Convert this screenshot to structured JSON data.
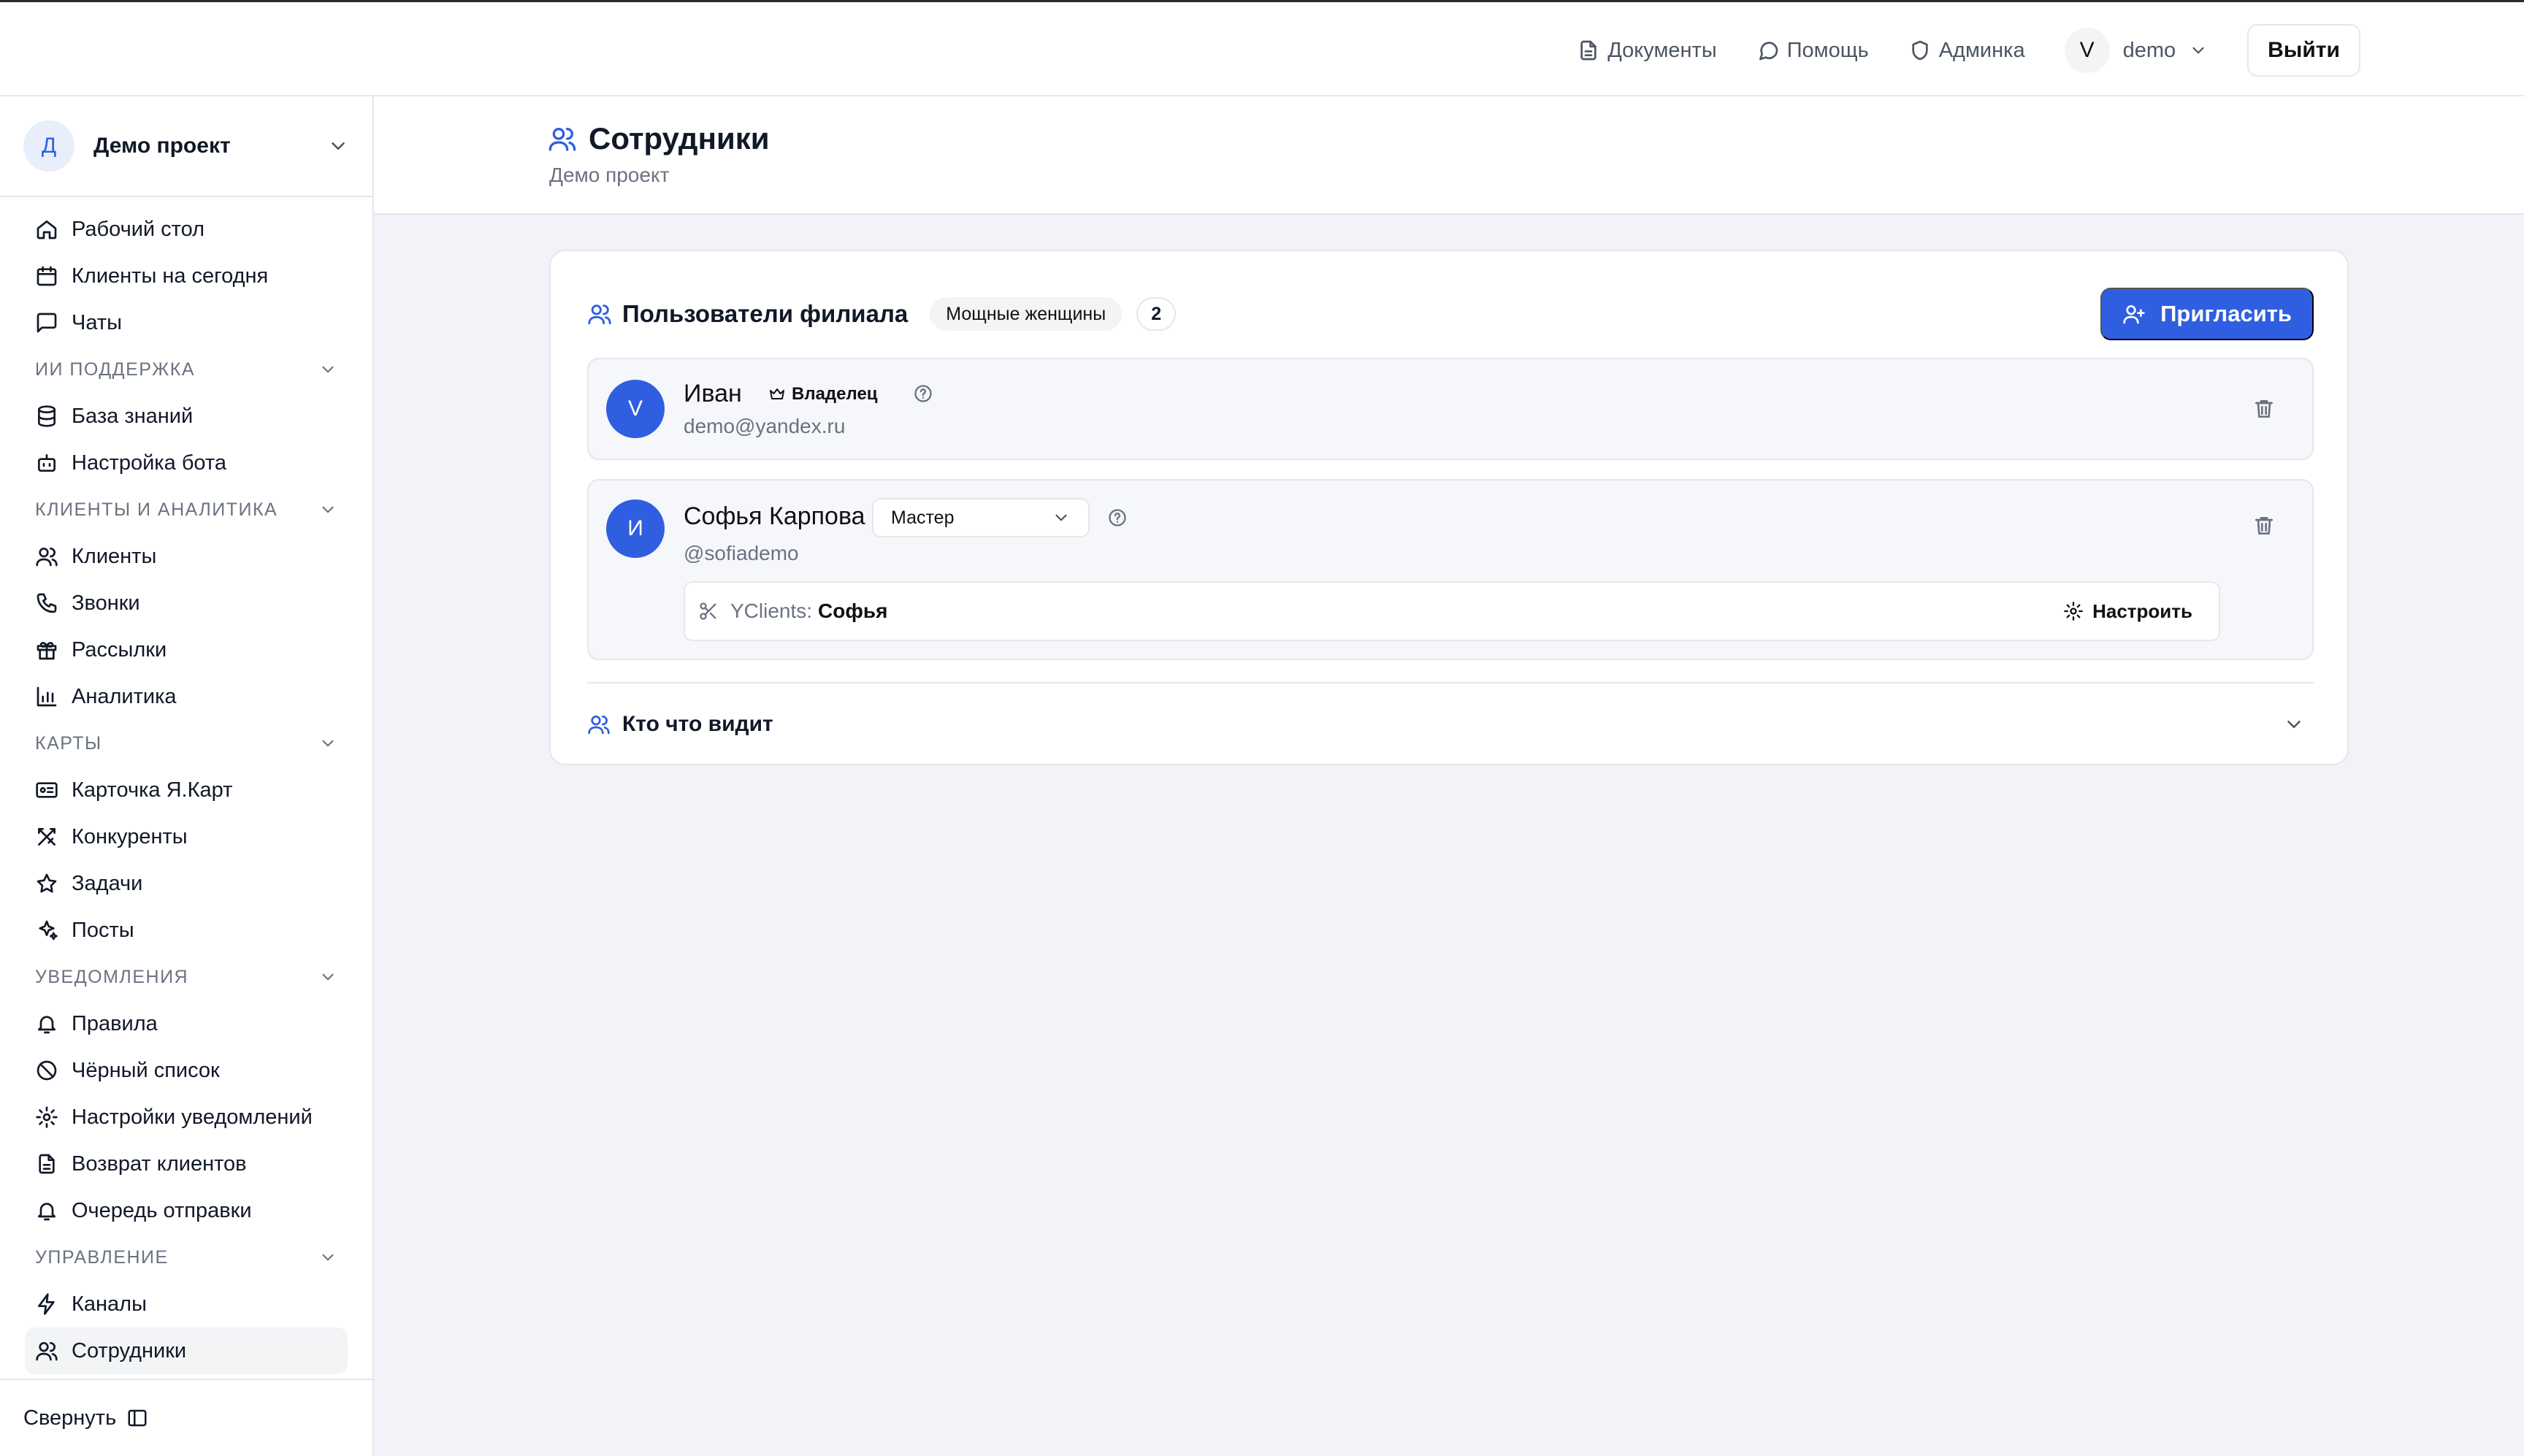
{
  "topbar": {
    "links": [
      {
        "label": "Документы",
        "icon": "document-icon"
      },
      {
        "label": "Помощь",
        "icon": "chat-bubble-icon"
      },
      {
        "label": "Админка",
        "icon": "shield-icon"
      }
    ],
    "user": {
      "avatar_letter": "V",
      "name": "demo"
    },
    "logout_label": "Выйти"
  },
  "sidebar": {
    "project": {
      "avatar_letter": "Д",
      "name": "Демо проект"
    },
    "top_items": [
      "Рабочий стол",
      "Клиенты на сегодня",
      "Чаты"
    ],
    "sections": [
      {
        "title": "ИИ ПОДДЕРЖКА",
        "items": [
          "База знаний",
          "Настройка бота"
        ]
      },
      {
        "title": "КЛИЕНТЫ И АНАЛИТИКА",
        "items": [
          "Клиенты",
          "Звонки",
          "Рассылки",
          "Аналитика"
        ]
      },
      {
        "title": "КАРТЫ",
        "items": [
          "Карточка Я.Карт",
          "Конкуренты",
          "Задачи",
          "Посты"
        ]
      },
      {
        "title": "УВЕДОМЛЕНИЯ",
        "items": [
          "Правила",
          "Чёрный список",
          "Настройки уведомлений",
          "Возврат клиентов",
          "Очередь отправки"
        ]
      },
      {
        "title": "УПРАВЛЕНИЕ",
        "items": [
          "Каналы",
          "Сотрудники"
        ]
      }
    ],
    "collapse_label": "Свернуть"
  },
  "page": {
    "title": "Сотрудники",
    "subtitle": "Демо проект"
  },
  "card": {
    "title": "Пользователи филиала",
    "branch": "Мощные женщины",
    "count": "2",
    "invite_label": "Пригласить",
    "users": [
      {
        "avatar_letter": "V",
        "name": "Иван",
        "badge": "Владелец",
        "email": "demo@yandex.ru"
      },
      {
        "avatar_letter": "И",
        "name": "Софья Карпова",
        "role": "Мастер",
        "handle": "@sofiademo",
        "integration": {
          "label": "YClients:",
          "value": "Софья",
          "action": "Настроить"
        }
      }
    ],
    "who_sees": "Кто что видит"
  },
  "colors": {
    "accent": "#2f5fe0",
    "background": "#f1f3f8"
  }
}
